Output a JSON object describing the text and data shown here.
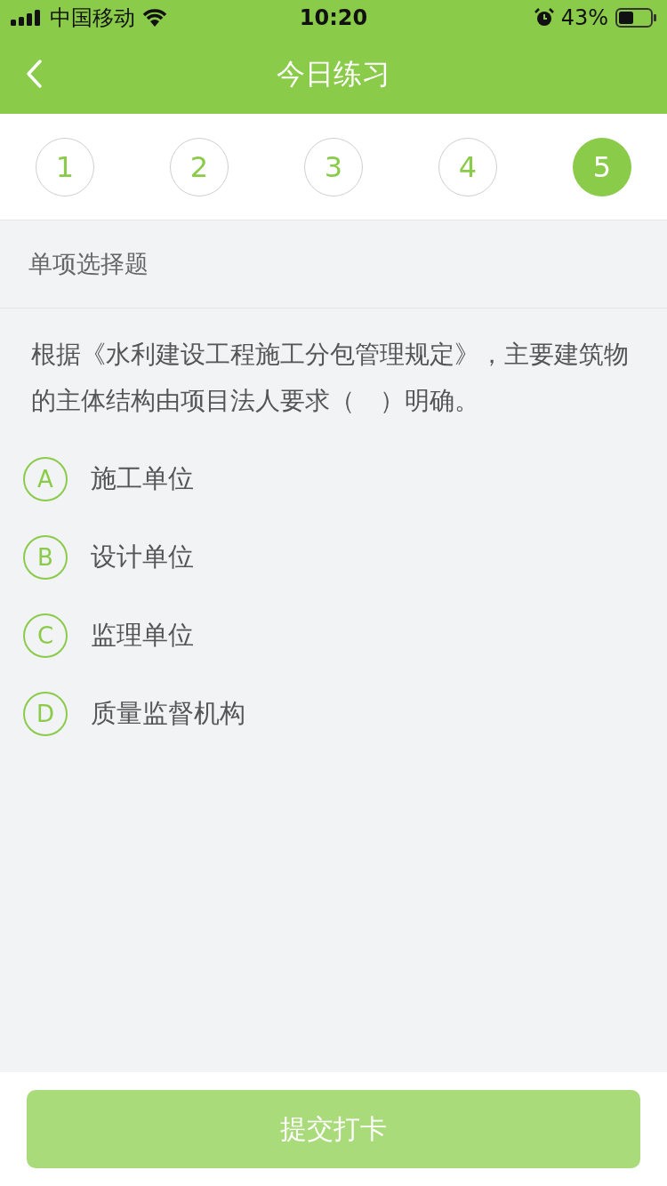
{
  "status_bar": {
    "carrier": "中国移动",
    "time": "10:20",
    "battery": "43%"
  },
  "nav": {
    "title": "今日练习"
  },
  "questions": [
    {
      "label": "1",
      "selected": false
    },
    {
      "label": "2",
      "selected": false
    },
    {
      "label": "3",
      "selected": false
    },
    {
      "label": "4",
      "selected": false
    },
    {
      "label": "5",
      "selected": true
    }
  ],
  "section": "单项选择题",
  "question": "根据《水利建设工程施工分包管理规定》，主要建筑物的主体结构由项目法人要求（　）明确。",
  "options": [
    {
      "letter": "A",
      "text": "施工单位",
      "selected": false
    },
    {
      "letter": "B",
      "text": "设计单位",
      "selected": false
    },
    {
      "letter": "C",
      "text": "监理单位",
      "selected": false
    },
    {
      "letter": "D",
      "text": "质量监督机构",
      "selected": false
    }
  ],
  "submit": {
    "label": "提交打卡",
    "disabled": true
  }
}
